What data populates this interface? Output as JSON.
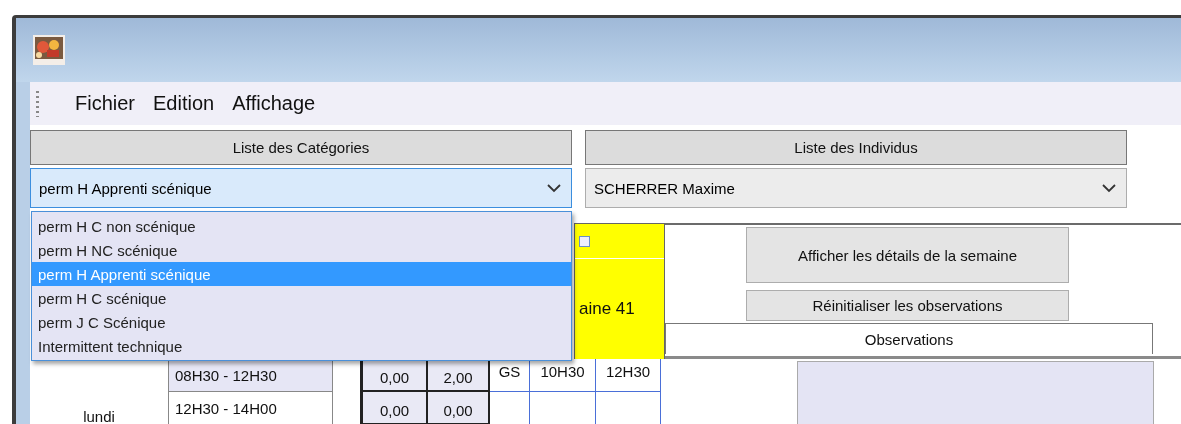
{
  "menu": [
    "Fichier",
    "Edition",
    "Affichage"
  ],
  "categories": {
    "header": "Liste des Catégories",
    "value": "perm H Apprenti scénique",
    "expanded": true,
    "options": [
      {
        "label": "perm H C non scénique",
        "selected": false
      },
      {
        "label": "perm H NC scénique",
        "selected": false
      },
      {
        "label": "perm H Apprenti scénique",
        "selected": true
      },
      {
        "label": "perm H C scénique",
        "selected": false
      },
      {
        "label": "perm J C Scénique",
        "selected": false
      },
      {
        "label": "Intermittent technique",
        "selected": false
      }
    ]
  },
  "individuals": {
    "header": "Liste des Individus",
    "value": "SCHERRER Maxime"
  },
  "week_panel": {
    "label": "aine 41",
    "checked": false
  },
  "buttons": [
    "Afficher les détails de la semaine",
    "Réinitialiser les observations"
  ],
  "observations": {
    "header": "Observations"
  },
  "schedule": {
    "day": "lundi",
    "rows": [
      {
        "slot": "08H30 - 12H30",
        "selected": true,
        "cells": [
          "0,00",
          "2,00",
          "GS",
          "10H30",
          "12H30"
        ]
      },
      {
        "slot": "12H30 - 14H00",
        "selected": false,
        "cells": [
          "0,00",
          "0,00"
        ]
      }
    ]
  }
}
